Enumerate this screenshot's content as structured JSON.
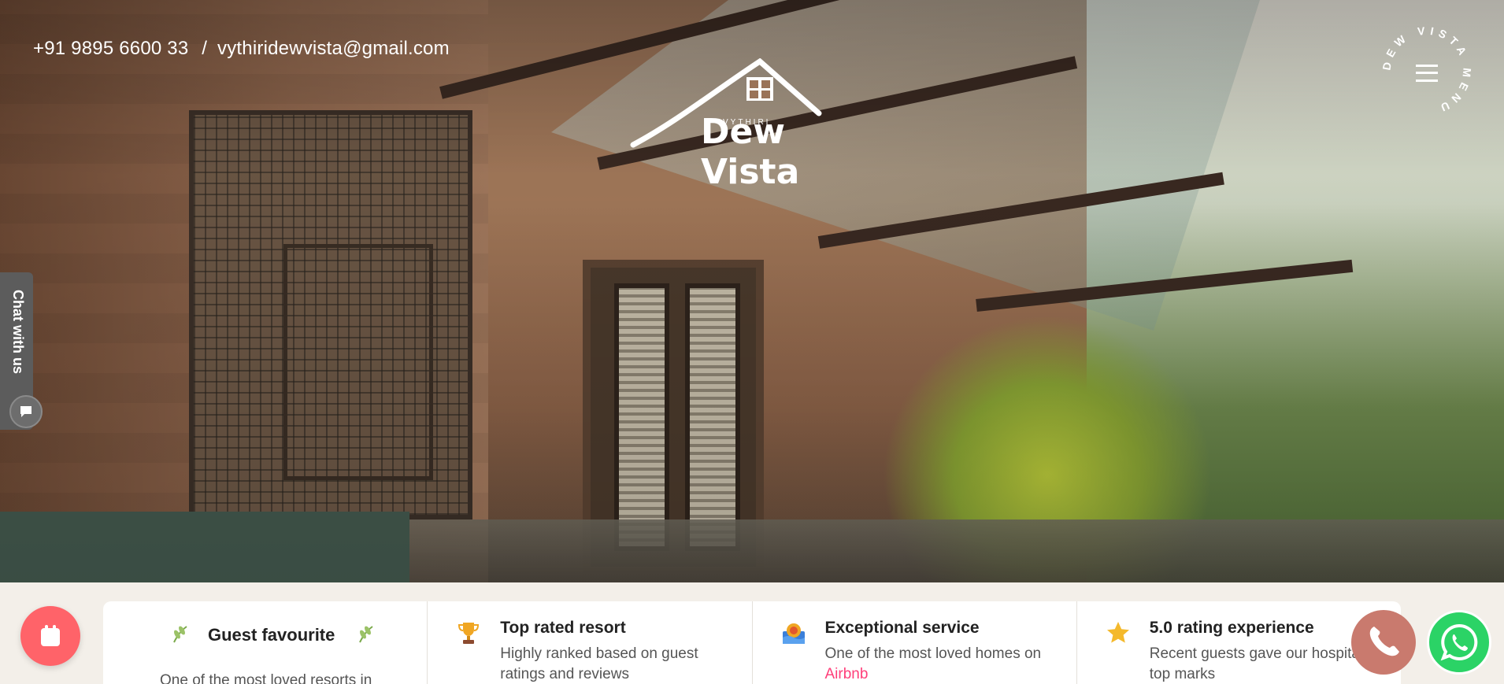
{
  "header": {
    "phone": "+91 9895 6600 33",
    "separator": "/",
    "email": "vythiridewvista@gmail.com"
  },
  "logo": {
    "brand_small": "VYTHIRI",
    "brand_big": "Dew Vista"
  },
  "menu": {
    "circle_text": "DEW VISTA MENU"
  },
  "chat": {
    "label": "Chat with us"
  },
  "features": [
    {
      "title": "Guest favourite",
      "desc": "One of the most loved resorts in"
    },
    {
      "title": "Top rated resort",
      "desc": "Highly ranked based on guest ratings and reviews"
    },
    {
      "title": "Exceptional service",
      "desc_prefix": "One of the most loved homes on",
      "desc_link": "Airbnb"
    },
    {
      "title": "5.0 rating experience",
      "desc": "Recent guests gave our hospitality top marks"
    }
  ],
  "icons": {
    "calendar": "calendar-icon",
    "phone": "phone-icon",
    "whatsapp": "whatsapp-icon",
    "trophy": "trophy-icon",
    "star": "star-icon",
    "service": "service-icon",
    "laurel": "laurel-icon",
    "chat": "chat-bubble-icon",
    "menu": "hamburger-icon"
  },
  "colors": {
    "calendar_btn": "#ff6369",
    "phone_btn": "#c97a6e",
    "whatsapp_btn": "#2bd366",
    "airbnb_link": "#ff3f7a"
  }
}
